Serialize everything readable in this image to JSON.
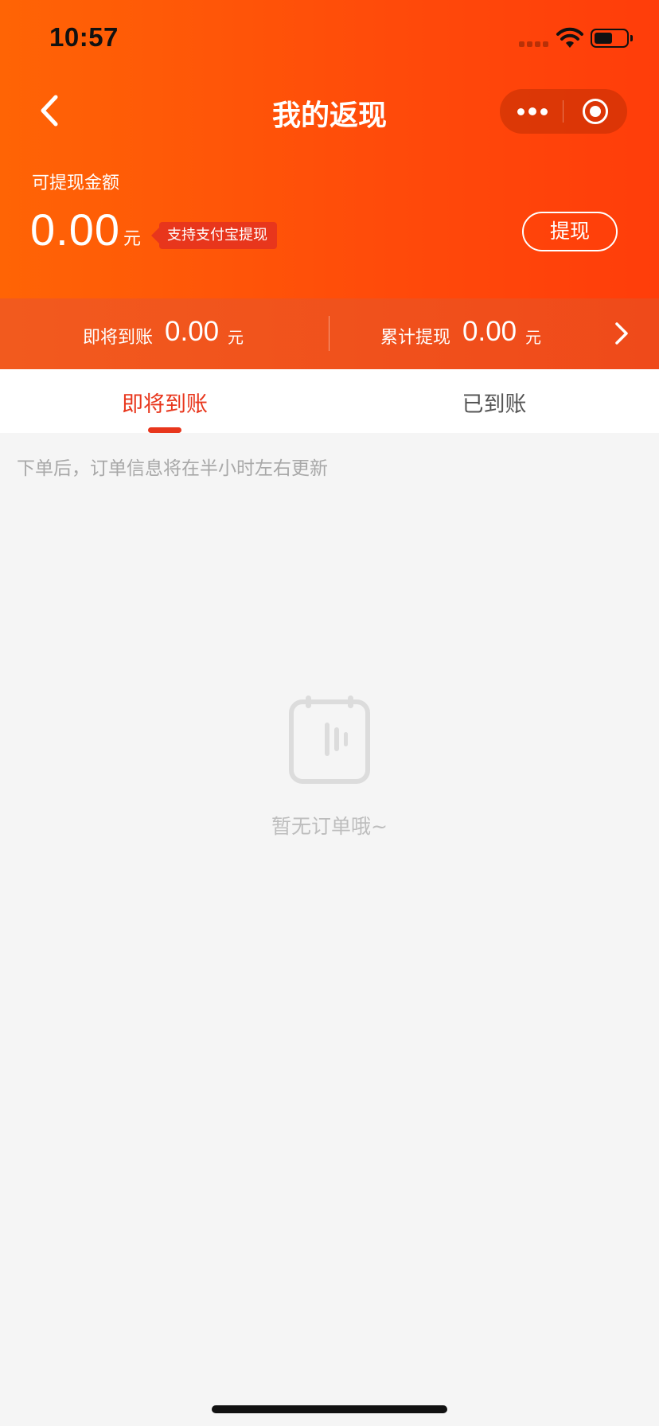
{
  "status_bar": {
    "time": "10:57"
  },
  "nav": {
    "title": "我的返现"
  },
  "balance": {
    "label": "可提现金额",
    "amount": "0.00",
    "unit": "元",
    "badge": "支持支付宝提现",
    "withdraw_label": "提现"
  },
  "summary": {
    "pending": {
      "label": "即将到账",
      "value": "0.00",
      "unit": "元"
    },
    "total": {
      "label": "累计提现",
      "value": "0.00",
      "unit": "元"
    }
  },
  "tabs": [
    {
      "label": "即将到账",
      "active": true
    },
    {
      "label": "已到账",
      "active": false
    }
  ],
  "hint": "下单后，订单信息将在半小时左右更新",
  "empty_state": {
    "text": "暂无订单哦~",
    "icon": "clipboard-icon"
  },
  "colors": {
    "accent": "#e8361c",
    "hero_start": "#ff6405",
    "hero_end": "#ff3d0a",
    "background": "#f5f5f5"
  }
}
